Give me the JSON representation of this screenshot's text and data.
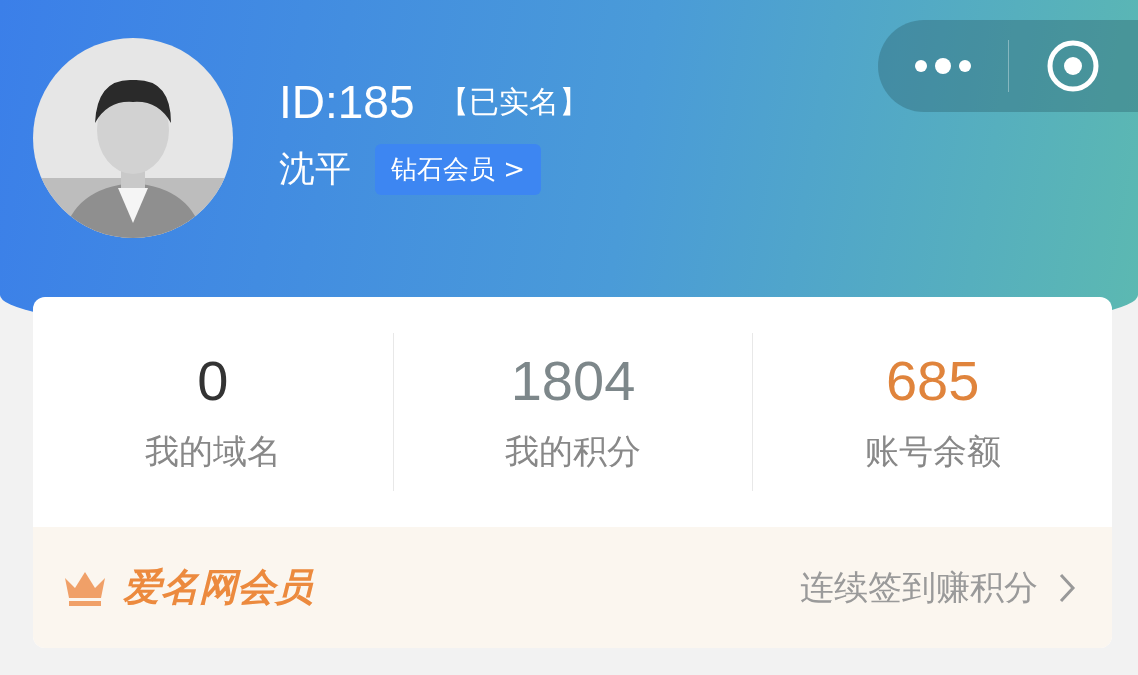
{
  "profile": {
    "id_label": "ID:185",
    "verified": "【已实名】",
    "name": "沈平",
    "badge": "钻石会员 >"
  },
  "stats": [
    {
      "value": "0",
      "label": "我的域名",
      "color": "#333333"
    },
    {
      "value": "1804",
      "label": "我的积分",
      "color": "#7d878a"
    },
    {
      "value": "685",
      "label": "账号余额",
      "color": "#e0843c"
    }
  ],
  "member_bar": {
    "title": "爱名网会员",
    "action": "连续签到赚积分"
  }
}
